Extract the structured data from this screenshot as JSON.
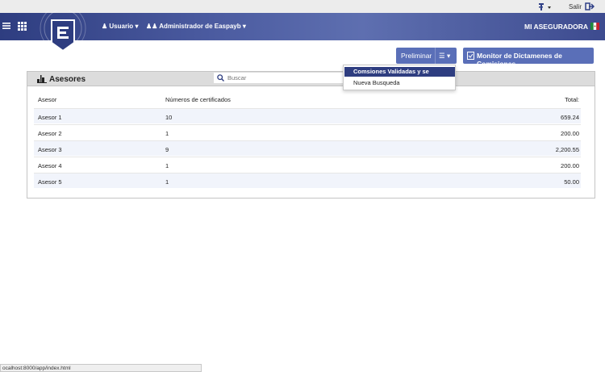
{
  "topbar": {
    "logout_label": "Salir",
    "icons": [
      "environment-icon",
      "logout-icon"
    ]
  },
  "navbar": {
    "user_label": "Usuario",
    "admin_label": "Administrador de Easpayb",
    "company_label": "MI ASEGURADORA",
    "icons": [
      "menu-icon",
      "apps-grid-icon",
      "user-icon",
      "users-icon",
      "mexico-flag-icon"
    ]
  },
  "toolbar": {
    "preliminar_label": "Preliminar",
    "monitor_label": "Monitor de Dictamenes de Comisiones"
  },
  "dropdown": {
    "items": [
      "Comsiones Validadas y se autorizan",
      "Nueva Busqueda"
    ],
    "selected": "Comsiones Validadas y se autorizan"
  },
  "panel": {
    "title": "Asesores",
    "search_placeholder": "Buscar",
    "columns": [
      "Asesor",
      "Números de certificados",
      "Total:"
    ],
    "rows": [
      [
        "Asesor 1",
        "10",
        "659.24"
      ],
      [
        "Asesor 2",
        "1",
        "200.00"
      ],
      [
        "Asesor 3",
        "9",
        "2,200.55"
      ],
      [
        "Asesor 4",
        "1",
        "200.00"
      ],
      [
        "Asesor 5",
        "1",
        "50.00"
      ]
    ]
  },
  "statusbar": {
    "url": "ocalhost:8000/app/index.html"
  },
  "colors": {
    "brand": "#2e3d80",
    "button": "#5a6fb8",
    "row_alt": "#f1f4fb"
  }
}
